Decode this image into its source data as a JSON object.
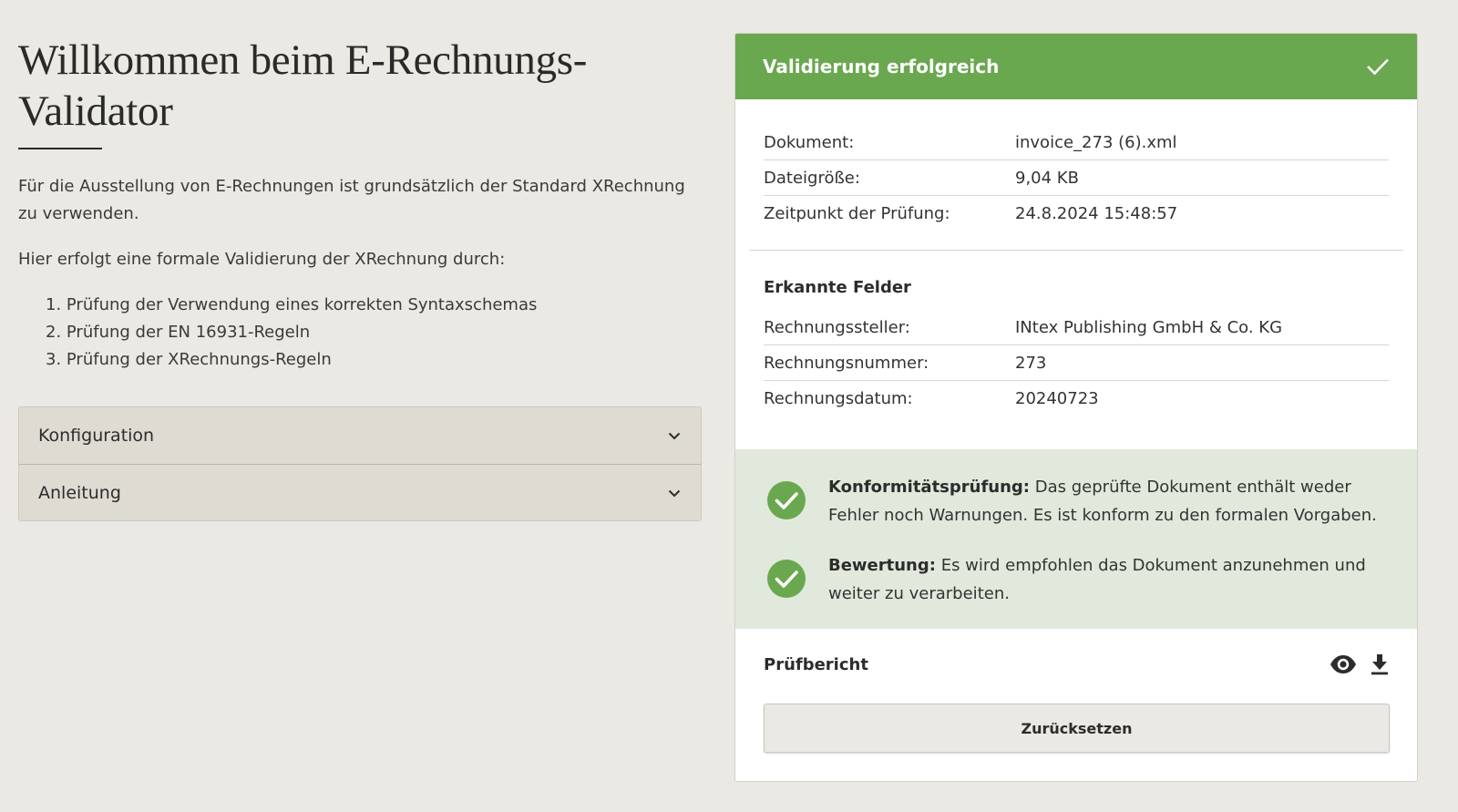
{
  "page": {
    "title": "Willkommen beim E-Rechnungs-Validator",
    "intro": "Für die Ausstellung von E-Rechnungen ist grundsätzlich der Standard XRechnung zu verwenden.",
    "intro2": "Hier erfolgt eine formale Validierung der XRechnung durch:",
    "steps": [
      "1. Prüfung der Verwendung eines korrekten Syntaxschemas",
      "2. Prüfung der EN 16931-Regeln",
      "3. Prüfung der XRechnungs-Regeln"
    ]
  },
  "accordion": [
    {
      "label": "Konfiguration"
    },
    {
      "label": "Anleitung"
    }
  ],
  "result": {
    "header_title": "Validierung erfolgreich",
    "header_color": "#6aa84f",
    "document": {
      "rows": [
        {
          "key": "Dokument:",
          "value": "invoice_273 (6).xml"
        },
        {
          "key": "Dateigröße:",
          "value": "9,04 KB"
        },
        {
          "key": "Zeitpunkt der Prüfung:",
          "value": "24.8.2024 15:48:57"
        }
      ]
    },
    "fields": {
      "title": "Erkannte Felder",
      "rows": [
        {
          "key": "Rechnungssteller:",
          "value": "INtex Publishing GmbH & Co. KG"
        },
        {
          "key": "Rechnungsnummer:",
          "value": "273"
        },
        {
          "key": "Rechnungsdatum:",
          "value": "20240723"
        }
      ]
    },
    "status": [
      {
        "label": "Konformitätsprüfung:",
        "text": "Das geprüfte Dokument enthält weder Fehler noch Warnungen. Es ist konform zu den formalen Vorgaben.",
        "icon": "check-circle-icon"
      },
      {
        "label": "Bewertung:",
        "text": "Es wird empfohlen das Dokument anzunehmen und weiter zu verarbeiten.",
        "icon": "check-circle-icon"
      }
    ],
    "status_color": "#6aa84f",
    "report": {
      "title": "Prüfbericht",
      "icons": [
        "eye-icon",
        "download-icon"
      ]
    },
    "reset_label": "Zurücksetzen"
  }
}
